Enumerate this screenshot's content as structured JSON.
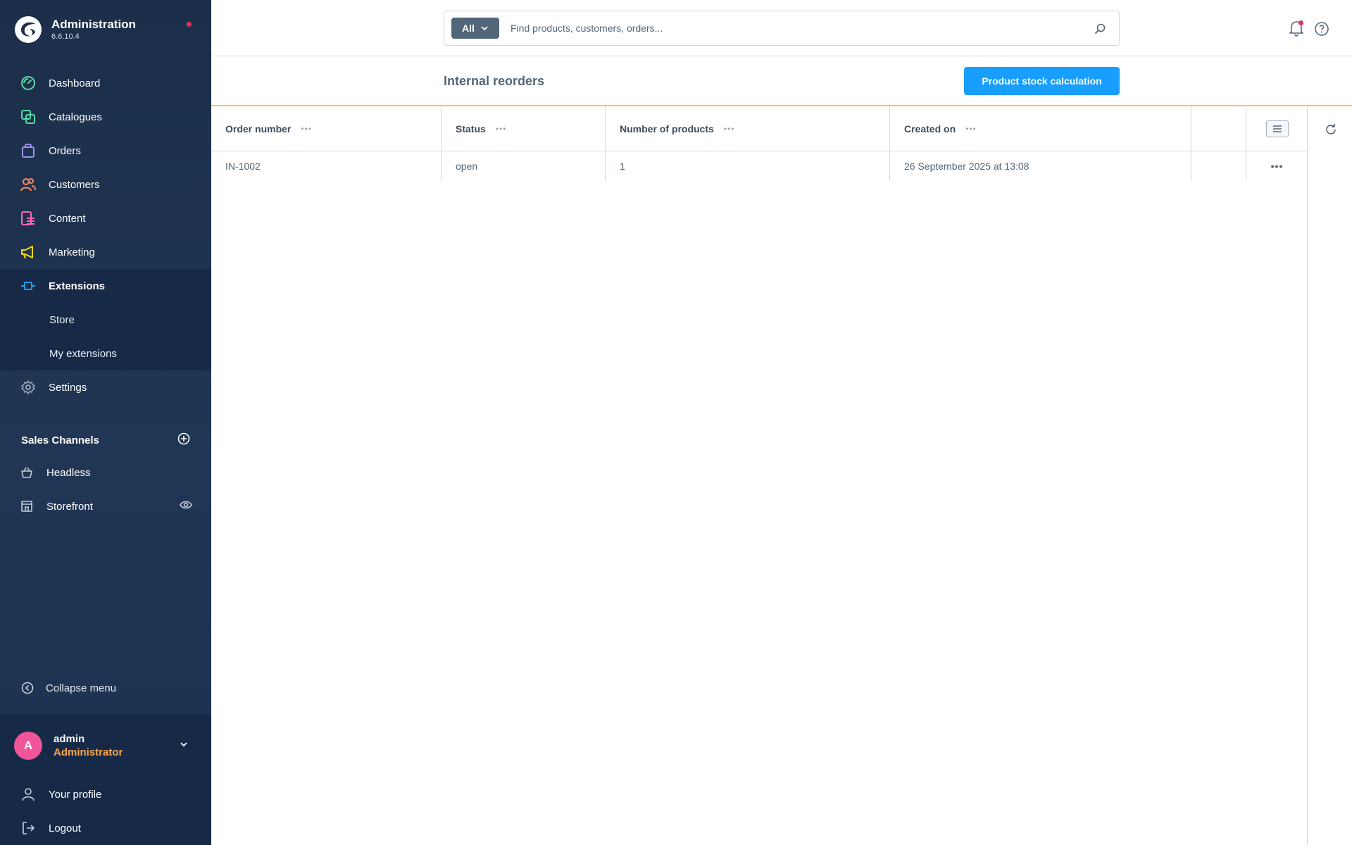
{
  "app": {
    "title": "Administration",
    "version": "6.6.10.4"
  },
  "nav": {
    "items": [
      {
        "label": "Dashboard",
        "icon": "dashboard-icon",
        "color": "#57d9a3"
      },
      {
        "label": "Catalogues",
        "icon": "catalogue-icon",
        "color": "#57d9a3"
      },
      {
        "label": "Orders",
        "icon": "orders-icon",
        "color": "#a092f0"
      },
      {
        "label": "Customers",
        "icon": "customers-icon",
        "color": "#f88962"
      },
      {
        "label": "Content",
        "icon": "content-icon",
        "color": "#ff68b4"
      },
      {
        "label": "Marketing",
        "icon": "marketing-icon",
        "color": "#ffd700"
      },
      {
        "label": "Extensions",
        "icon": "extensions-icon",
        "color": "#189eff"
      },
      {
        "label": "Settings",
        "icon": "settings-icon",
        "color": "#9aa8b5"
      }
    ],
    "extensions_sub": [
      "Store",
      "My extensions"
    ],
    "active": "Extensions"
  },
  "sales_channels": {
    "title": "Sales Channels",
    "items": [
      {
        "label": "Headless",
        "icon": "basket-icon"
      },
      {
        "label": "Storefront",
        "icon": "storefront-icon"
      }
    ]
  },
  "sidebar_footer": {
    "collapse_label": "Collapse menu",
    "user": {
      "initial": "A",
      "name": "admin",
      "role": "Administrator"
    },
    "menu": [
      "Your profile",
      "Logout"
    ]
  },
  "search": {
    "type_label": "All",
    "placeholder": "Find products, customers, orders..."
  },
  "page": {
    "title": "Internal reorders",
    "primary_action": "Product stock calculation"
  },
  "grid": {
    "columns": [
      "Order number",
      "Status",
      "Number of products",
      "Created on"
    ],
    "rows": [
      {
        "order_number": "IN-1002",
        "status": "open",
        "products": "1",
        "created_on": "26 September 2025 at 13:08"
      }
    ]
  },
  "colors": {
    "sidebar_bg": "#1b2f4a",
    "accent": "#189eff",
    "smartbar_border": "#ffbd5d",
    "role": "#ffa54a",
    "avatar": "#f0559a",
    "notification_dot": "#e1315b"
  }
}
